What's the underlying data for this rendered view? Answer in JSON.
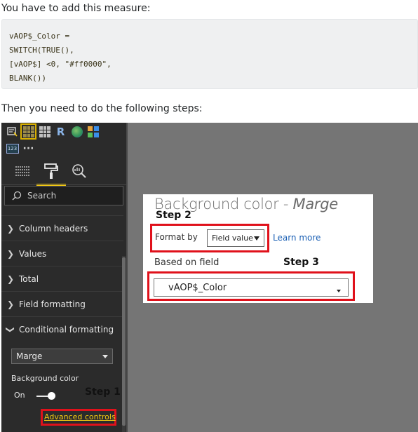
{
  "intro_text": "You have to add this measure:",
  "code_lines": [
    "vAOP$_Color =",
    "SWITCH(TRUE(),",
    "[vAOP$] <0, \"#ff0000\",",
    "BLANK())"
  ],
  "then_text": "Then you need to do the following steps:",
  "pane": {
    "viz_icons": [
      "table-field-icon",
      "table-icon",
      "matrix-icon",
      "r-visual-icon",
      "globe-icon",
      "tiles-icon",
      "card-123-icon",
      "more-icon"
    ],
    "viz_r_label": "R",
    "viz_123_label": "123",
    "more_label": "···",
    "tabs": [
      "fields-tab",
      "format-tab",
      "analytics-tab"
    ],
    "search_placeholder": "Search",
    "sections": [
      {
        "label": "Column headers",
        "expanded": false
      },
      {
        "label": "Values",
        "expanded": false
      },
      {
        "label": "Total",
        "expanded": false
      },
      {
        "label": "Field formatting",
        "expanded": false
      },
      {
        "label": "Conditional formatting",
        "expanded": true
      }
    ],
    "series_dropdown": "Marge",
    "background_color_label": "Background color",
    "toggle_label": "On",
    "advanced_controls": "Advanced controls"
  },
  "annotations": {
    "step1": "Step 1",
    "step2": "Step 2",
    "step3": "Step 3",
    "highlight_color": "#e0111b"
  },
  "dialog": {
    "title_prefix": "Background color - ",
    "title_series": "Marge",
    "format_by_label": "Format by",
    "format_by_value": "Field value",
    "learn_more": "Learn more",
    "based_on_field_label": "Based on field",
    "field_value": "vAOP$_Color"
  },
  "colors": {
    "accent": "#f2c811",
    "pane_bg": "#2b2b2b",
    "canvas_bg": "#757575",
    "link": "#1a5fb4"
  }
}
